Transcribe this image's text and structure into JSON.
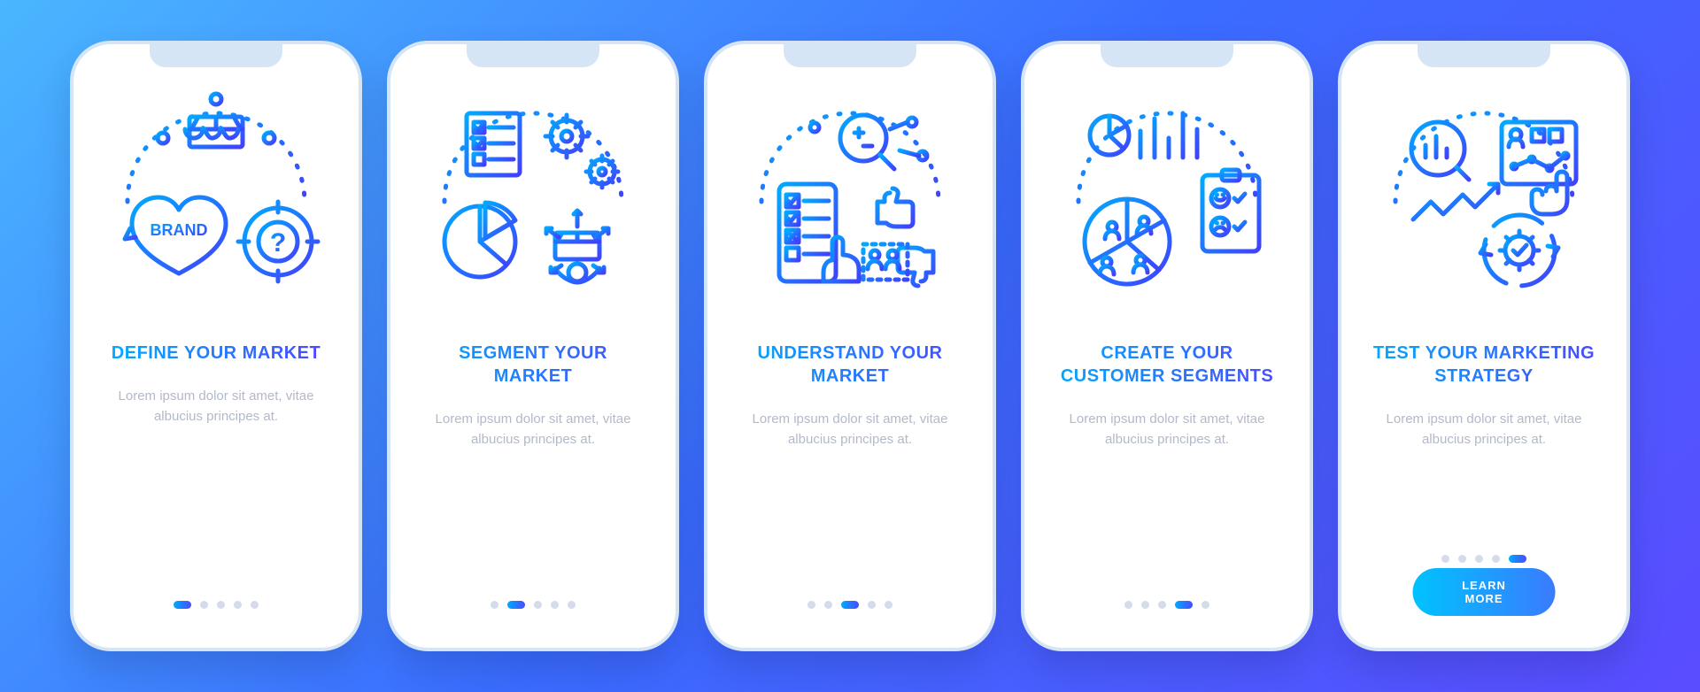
{
  "cta_label": "LEARN MORE",
  "lorem": "Lorem ipsum dolor sit amet, vitae albucius principes at.",
  "screens": [
    {
      "title": "DEFINE YOUR MARKET",
      "icon": "define-icon"
    },
    {
      "title": "SEGMENT YOUR MARKET",
      "icon": "segment-icon"
    },
    {
      "title": "UNDERSTAND YOUR MARKET",
      "icon": "understand-icon"
    },
    {
      "title": "CREATE YOUR CUSTOMER SEGMENTS",
      "icon": "create-icon"
    },
    {
      "title": "TEST YOUR MARKETING STRATEGY",
      "icon": "test-icon"
    }
  ],
  "colors": {
    "grad_start": "#00aaff",
    "grad_end": "#4040ff",
    "bg_start": "#4ab6ff",
    "bg_end": "#5a4cff"
  }
}
